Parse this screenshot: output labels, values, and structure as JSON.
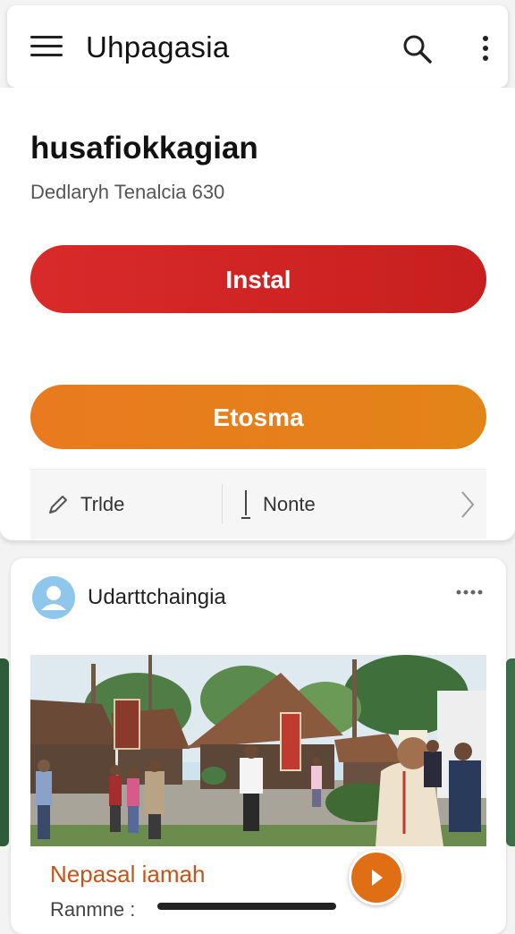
{
  "header": {
    "title": "Uhpagasia",
    "menu_icon": "hamburger-menu-icon",
    "search_icon": "search-icon",
    "more_icon": "more-vertical-icon"
  },
  "app": {
    "title": "husafiokkagian",
    "subtitle": "Dedlaryh Tenalcia 630"
  },
  "buttons": {
    "install_label": "Instal",
    "second_label": "Etosma",
    "install_color": "#d92a2a",
    "second_color": "#e97a1f"
  },
  "actions": {
    "trade_label": "Trlde",
    "note_label": "Nonte"
  },
  "post": {
    "author": "Udarttchaingia",
    "caption": "Nepasal iamah",
    "meta": "Ranmne :"
  }
}
